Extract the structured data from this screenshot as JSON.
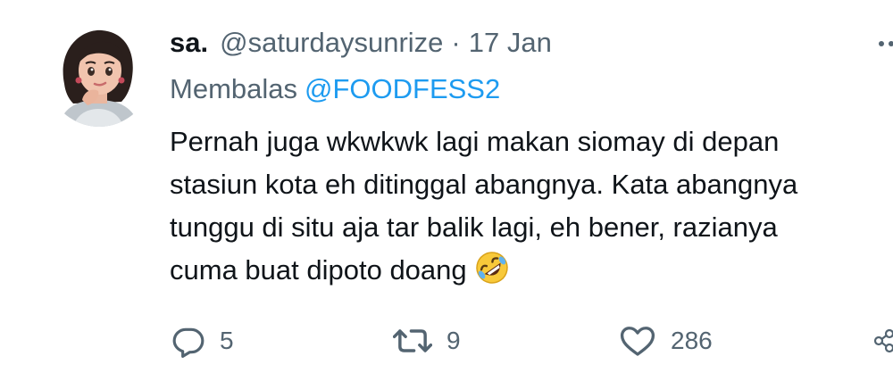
{
  "tweet": {
    "display_name": "sa.",
    "handle": "@saturdaysunrize",
    "separator": "·",
    "date": "17 Jan",
    "reply_label": "Membalas",
    "reply_to": "@FOODFESS2",
    "text_lines": [
      "Pernah juga wkwkwk lagi makan siomay di depan",
      "stasiun kota eh ditinggal abangnya. Kata abangnya",
      "tunggu di situ aja tar balik lagi, eh bener, razianya",
      "cuma buat dipoto doang"
    ],
    "emoji": "rolling-on-floor-laughing"
  },
  "actions": {
    "reply_count": "5",
    "retweet_count": "9",
    "like_count": "286"
  },
  "colors": {
    "text": "#0f1419",
    "secondary": "#536471",
    "accent": "#1d9bf0"
  },
  "icons": [
    "more-icon",
    "reply-icon",
    "retweet-icon",
    "like-icon",
    "share-icon"
  ]
}
